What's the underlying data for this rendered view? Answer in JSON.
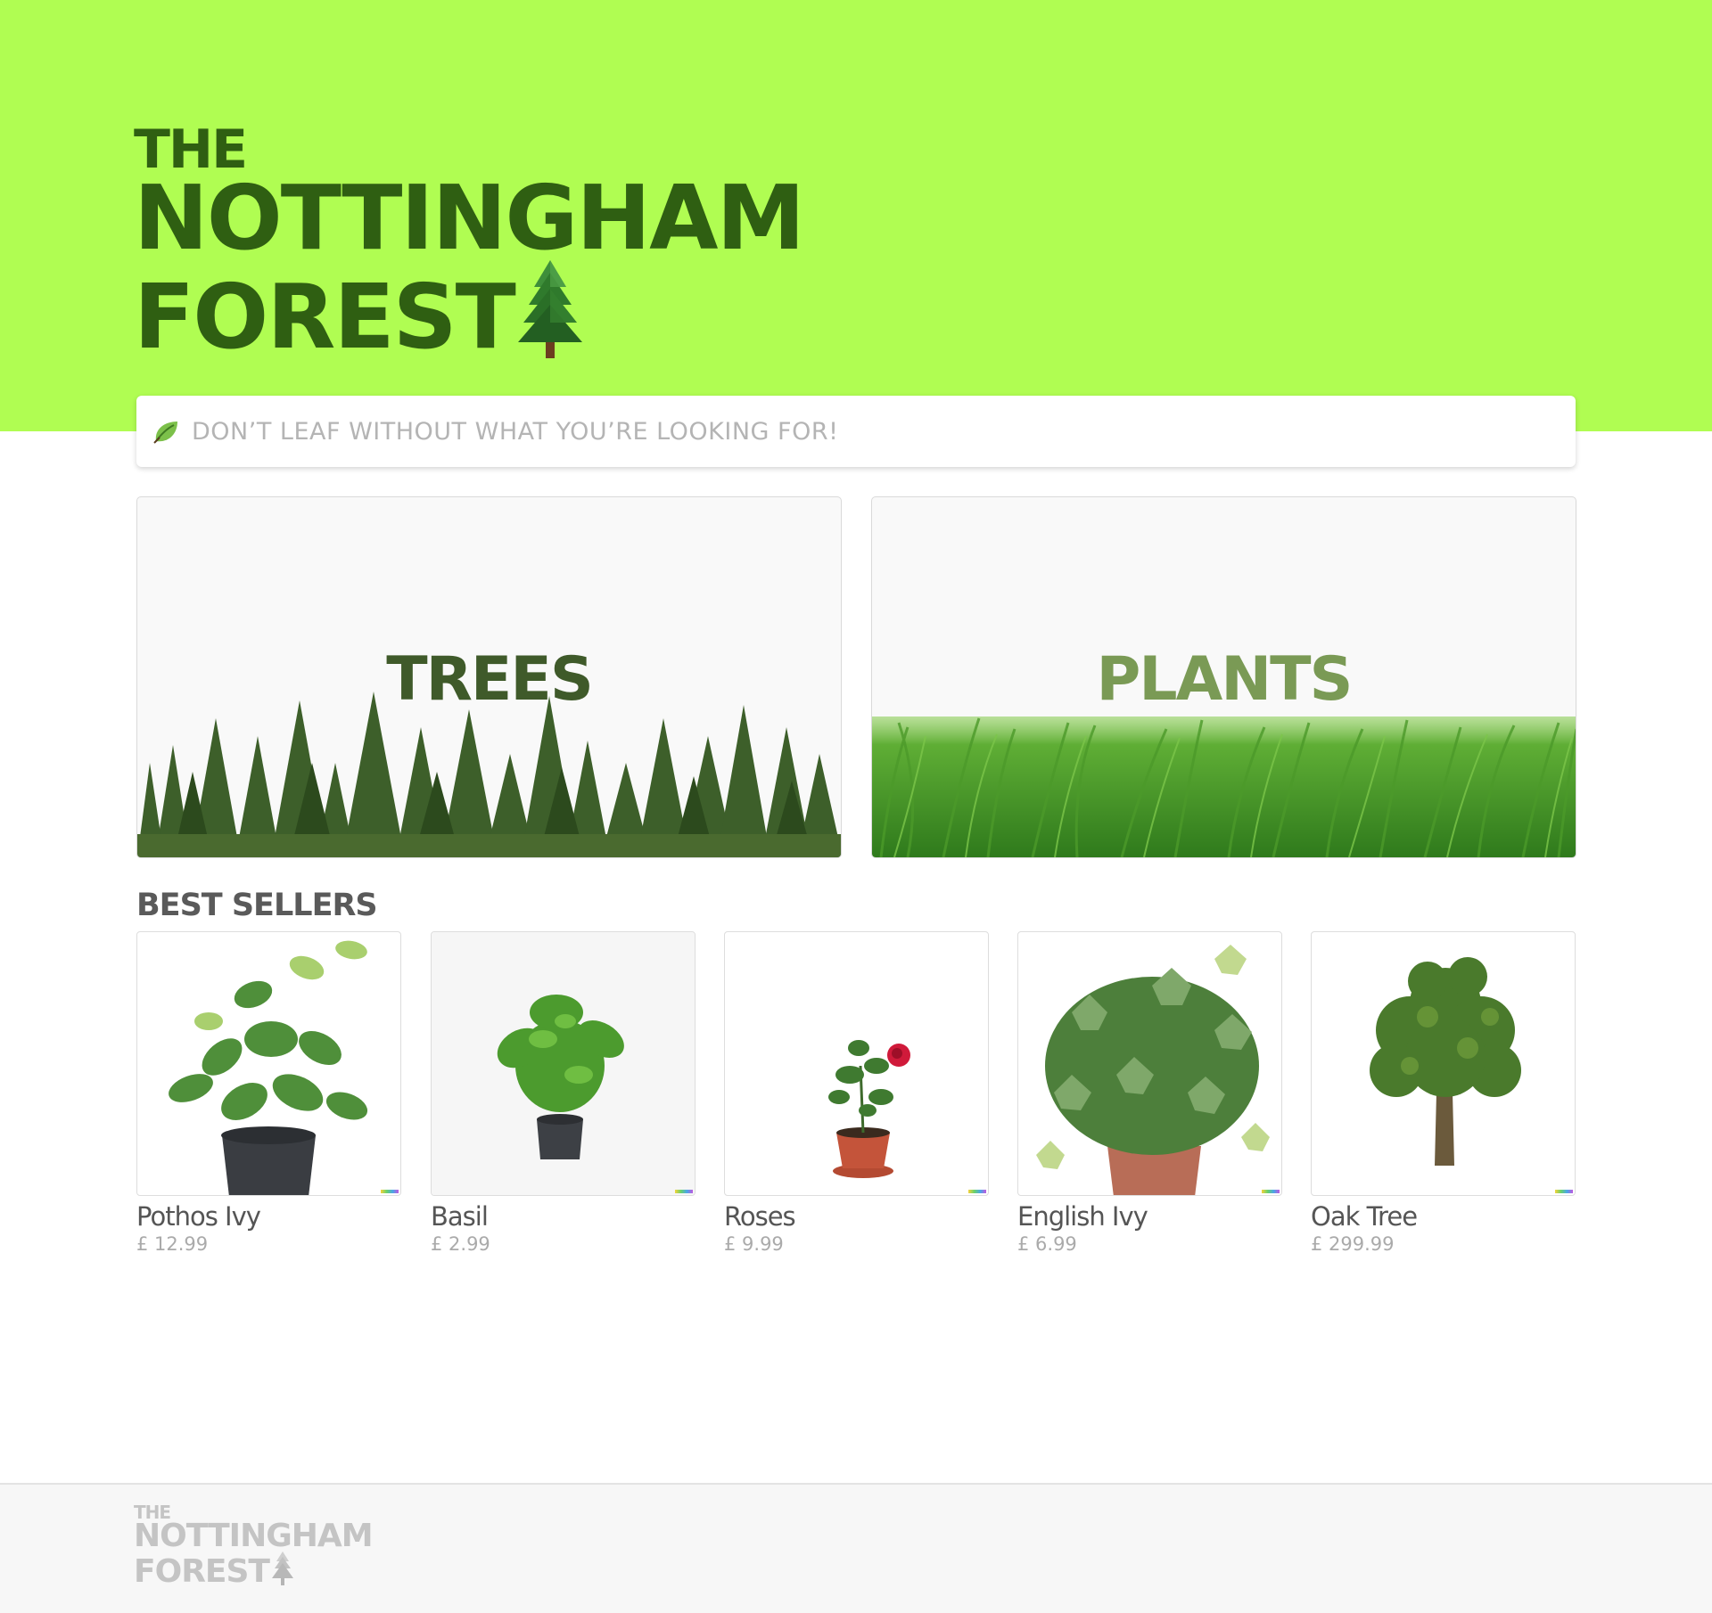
{
  "brand": {
    "line1": "THE",
    "line2": "NOTTINGHAM",
    "line3": "FOREST",
    "logo_icon": "evergreen-tree-icon",
    "colors": {
      "header_bg": "#b0fd52",
      "logo_text": "#2f5f12"
    }
  },
  "search": {
    "placeholder": "DON’T LEAF WITHOUT WHAT YOU’RE LOOKING FOR!",
    "icon": "leaf-icon"
  },
  "categories": [
    {
      "label": "TREES",
      "image": "evergreen-forest-image"
    },
    {
      "label": "PLANTS",
      "image": "grass-field-image"
    }
  ],
  "best_sellers": {
    "title": "BEST SELLERS",
    "products": [
      {
        "name": "Pothos Ivy",
        "price": "£ 12.99",
        "image": "pothos-ivy-image"
      },
      {
        "name": "Basil",
        "price": "£ 2.99",
        "image": "basil-image"
      },
      {
        "name": "Roses",
        "price": "£ 9.99",
        "image": "roses-image"
      },
      {
        "name": "English Ivy",
        "price": "£ 6.99",
        "image": "english-ivy-image"
      },
      {
        "name": "Oak Tree",
        "price": "£ 299.99",
        "image": "oak-tree-image"
      }
    ]
  },
  "footer": {
    "line1": "THE",
    "line2": "NOTTINGHAM",
    "line3": "FOREST",
    "logo_icon": "evergreen-tree-icon"
  }
}
